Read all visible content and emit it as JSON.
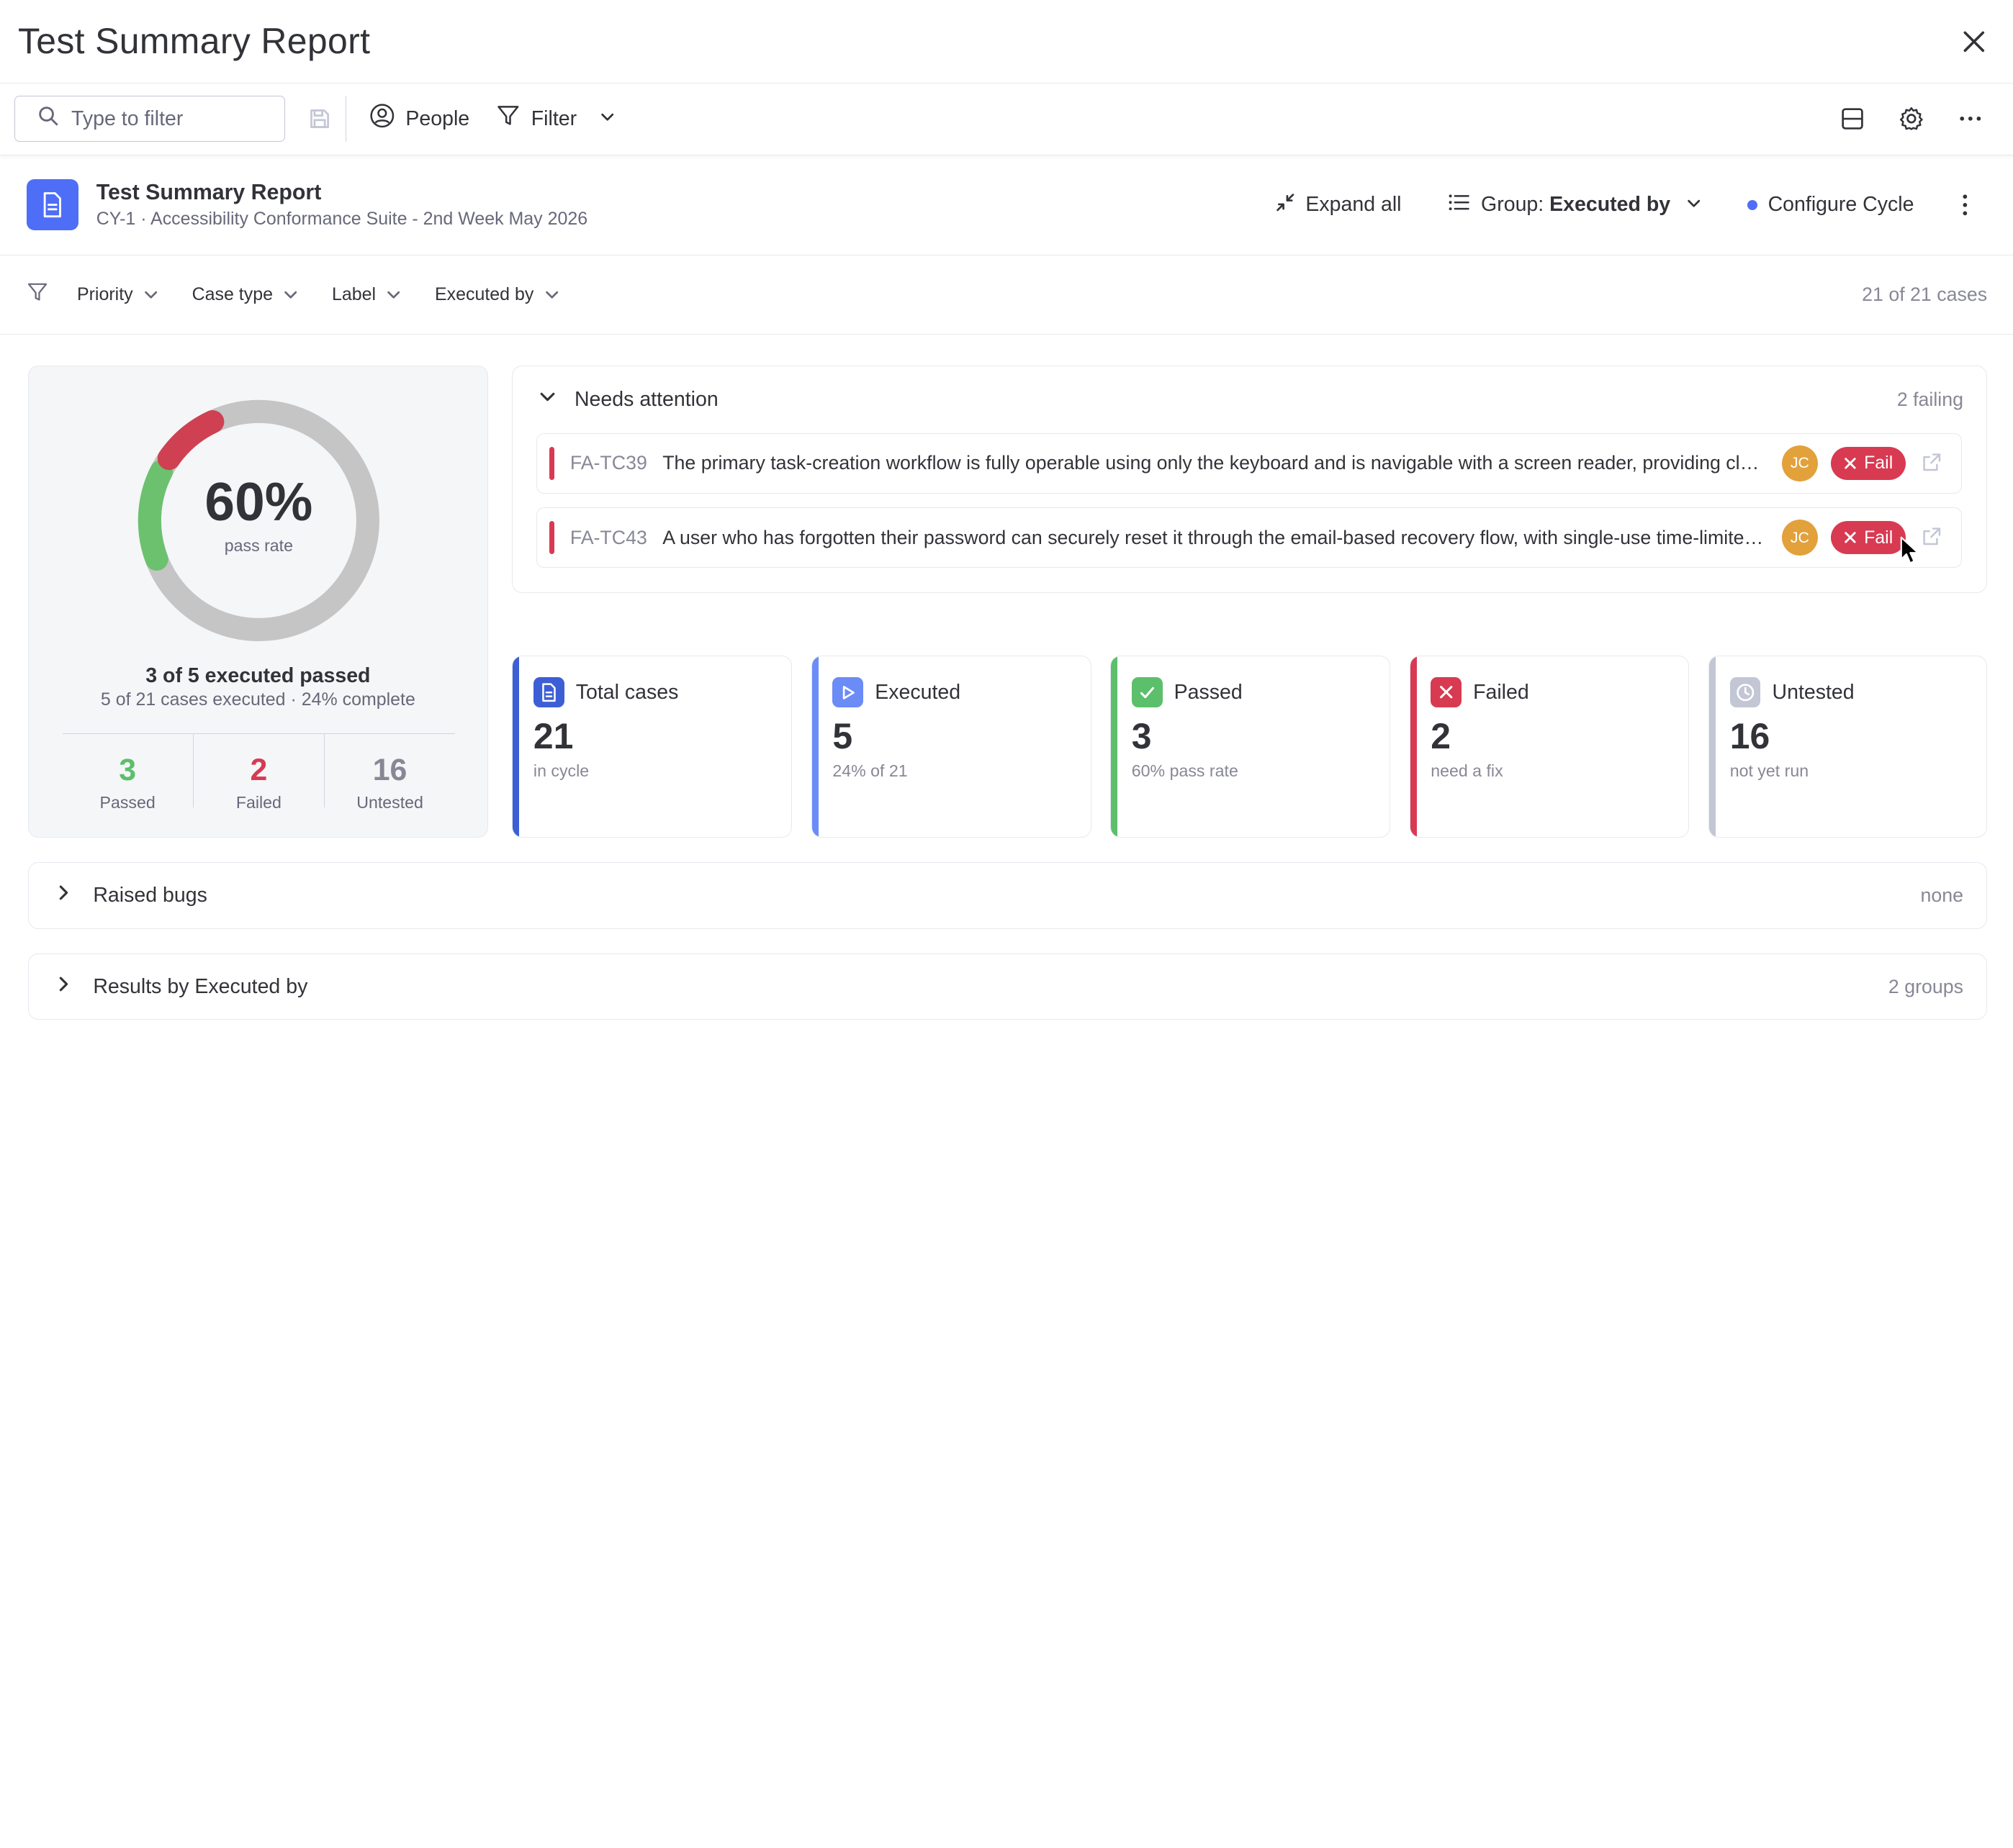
{
  "window": {
    "title": "Test Summary Report"
  },
  "toolbar": {
    "search_placeholder": "Type to filter",
    "people_label": "People",
    "filter_label": "Filter"
  },
  "report": {
    "title": "Test Summary Report",
    "subtitle": "CY-1 · Accessibility Conformance Suite - 2nd Week May 2026",
    "expand_all_label": "Expand all",
    "group_prefix": "Group:",
    "group_value": "Executed by",
    "configure_label": "Configure Cycle",
    "accent_color": "#4f6ef7"
  },
  "filters": {
    "items": [
      "Priority",
      "Case type",
      "Label",
      "Executed by"
    ],
    "count_text": "21 of 21 cases"
  },
  "summary": {
    "pass_rate_pct": "60%",
    "pass_rate_label": "pass rate",
    "pass_fraction_of_executed": 0.6,
    "headline": "3 of 5 executed passed",
    "subline": "5 of 21 cases executed · 24% complete",
    "stats": [
      {
        "value": "3",
        "label": "Passed",
        "color": "#5cbf6b"
      },
      {
        "value": "2",
        "label": "Failed",
        "color": "#d83a52"
      },
      {
        "value": "16",
        "label": "Untested",
        "color": "#878895"
      }
    ],
    "donut": {
      "total": 21,
      "passed": 3,
      "failed": 2,
      "untested": 16
    }
  },
  "attention": {
    "title": "Needs attention",
    "count_text": "2 failing",
    "rows": [
      {
        "id": "FA-TC39",
        "text": "The primary task-creation workflow is fully operable using only the keyboard and is navigable with a screen reader, providing clear focus indicators and accessible labels",
        "avatar": "JC",
        "status": "Fail"
      },
      {
        "id": "FA-TC43",
        "text": "A user who has forgotten their password can securely reset it through the email-based recovery flow, with single-use time-limited links",
        "avatar": "JC",
        "status": "Fail"
      }
    ]
  },
  "cards": [
    {
      "label": "Total cases",
      "value": "21",
      "sub": "in cycle",
      "color": "#3d5fd6",
      "icon": "document-icon"
    },
    {
      "label": "Executed",
      "value": "5",
      "sub": "24% of 21",
      "color": "#6b8cf7",
      "icon": "play-icon"
    },
    {
      "label": "Passed",
      "value": "3",
      "sub": "60% pass rate",
      "color": "#5cbf6b",
      "icon": "check-icon"
    },
    {
      "label": "Failed",
      "value": "2",
      "sub": "need a fix",
      "color": "#d83a52",
      "icon": "x-icon"
    },
    {
      "label": "Untested",
      "value": "16",
      "sub": "not yet run",
      "color": "#c3c6d4",
      "icon": "clock-icon"
    }
  ],
  "sections": [
    {
      "title": "Raised bugs",
      "right": "none"
    },
    {
      "title": "Results by Executed by",
      "right": "2 groups"
    }
  ]
}
